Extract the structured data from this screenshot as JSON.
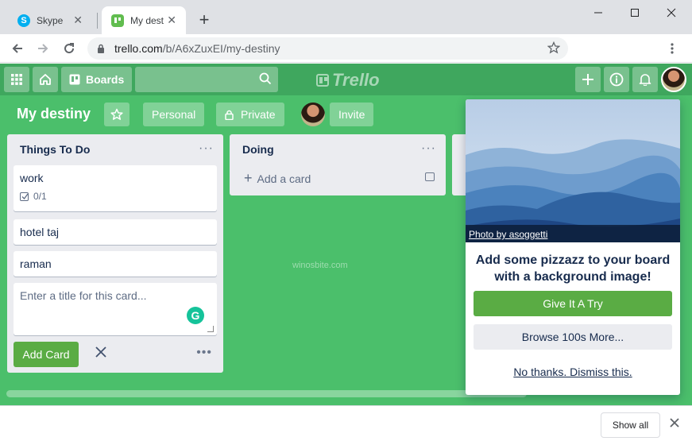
{
  "browser": {
    "tabs": [
      {
        "title": "Skype",
        "icon": "skype-icon",
        "color": "#00aff0"
      },
      {
        "title": "My destiny",
        "icon": "trello-icon",
        "color": "#61bd4f"
      }
    ],
    "url_host": "trello.com",
    "url_path": "/b/A6xZuxEI/my-destiny"
  },
  "header": {
    "boards_label": "Boards",
    "logo_text": "Trello"
  },
  "board": {
    "title": "My destiny",
    "team_label": "Personal",
    "visibility_label": "Private",
    "invite_label": "Invite",
    "background_color": "#4bbf6b"
  },
  "lists": [
    {
      "title": "Things To Do",
      "cards": [
        {
          "title": "work",
          "checklist": "0/1"
        },
        {
          "title": "hotel taj"
        },
        {
          "title": "raman"
        }
      ],
      "composer_placeholder": "Enter a title for this card...",
      "add_button": "Add Card"
    },
    {
      "title": "Doing",
      "add_card_label": "Add a card"
    }
  ],
  "watermark": "winosbite.com",
  "popup": {
    "photo_credit": "Photo by asoggetti",
    "heading": "Add some pizzazz to your board with a background image!",
    "primary_button": "Give It A Try",
    "secondary_button": "Browse 100s More...",
    "dismiss_link": "No thanks. Dismiss this."
  },
  "download_bar": {
    "show_all_label": "Show all"
  }
}
